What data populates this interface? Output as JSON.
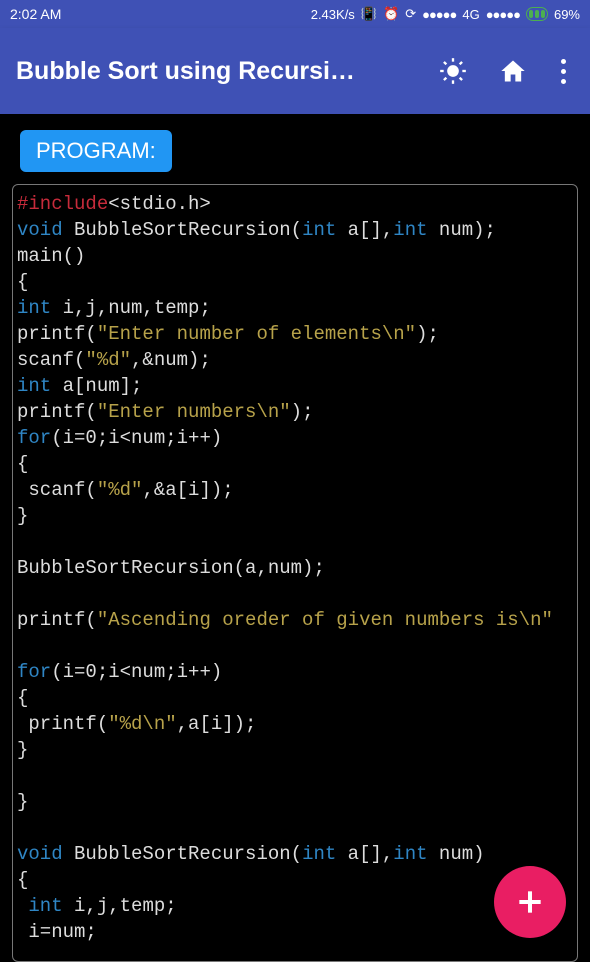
{
  "status": {
    "time": "2:02 AM",
    "net_speed": "2.43K/s",
    "network_label": "4G",
    "battery_pct": "69%"
  },
  "appbar": {
    "title": "Bubble Sort using Recursi…"
  },
  "section": {
    "program_label": "PROGRAM:"
  },
  "code": {
    "tokens": [
      {
        "t": "kw-pre",
        "v": "#include"
      },
      {
        "t": "txt",
        "v": "<stdio.h>\n"
      },
      {
        "t": "kw-type",
        "v": "void"
      },
      {
        "t": "txt",
        "v": " BubbleSortRecursion("
      },
      {
        "t": "kw-type",
        "v": "int"
      },
      {
        "t": "txt",
        "v": " a[],"
      },
      {
        "t": "kw-type",
        "v": "int"
      },
      {
        "t": "txt",
        "v": " num);\n"
      },
      {
        "t": "txt",
        "v": "main()\n"
      },
      {
        "t": "txt",
        "v": "{\n"
      },
      {
        "t": "kw-type",
        "v": "int"
      },
      {
        "t": "txt",
        "v": " i,j,num,temp;\n"
      },
      {
        "t": "txt",
        "v": "printf("
      },
      {
        "t": "str",
        "v": "\"Enter number of elements\\n\""
      },
      {
        "t": "txt",
        "v": ");\n"
      },
      {
        "t": "txt",
        "v": "scanf("
      },
      {
        "t": "str",
        "v": "\"%d\""
      },
      {
        "t": "txt",
        "v": ",&num);\n"
      },
      {
        "t": "kw-type",
        "v": "int"
      },
      {
        "t": "txt",
        "v": " a[num];\n"
      },
      {
        "t": "txt",
        "v": "printf("
      },
      {
        "t": "str",
        "v": "\"Enter numbers\\n\""
      },
      {
        "t": "txt",
        "v": ");\n"
      },
      {
        "t": "kw-type",
        "v": "for"
      },
      {
        "t": "txt",
        "v": "(i=0;i<num;i++)\n"
      },
      {
        "t": "txt",
        "v": "{\n"
      },
      {
        "t": "txt",
        "v": " scanf("
      },
      {
        "t": "str",
        "v": "\"%d\""
      },
      {
        "t": "txt",
        "v": ",&a[i]);\n"
      },
      {
        "t": "txt",
        "v": "}\n"
      },
      {
        "t": "txt",
        "v": "\n"
      },
      {
        "t": "txt",
        "v": "BubbleSortRecursion(a,num);\n"
      },
      {
        "t": "txt",
        "v": "\n"
      },
      {
        "t": "txt",
        "v": "printf("
      },
      {
        "t": "str",
        "v": "\"Ascending oreder of given numbers is\\n\""
      },
      {
        "t": "txt",
        "v": "\n"
      },
      {
        "t": "txt",
        "v": "\n"
      },
      {
        "t": "kw-type",
        "v": "for"
      },
      {
        "t": "txt",
        "v": "(i=0;i<num;i++)\n"
      },
      {
        "t": "txt",
        "v": "{\n"
      },
      {
        "t": "txt",
        "v": " printf("
      },
      {
        "t": "str",
        "v": "\"%d\\n\""
      },
      {
        "t": "txt",
        "v": ",a[i]);\n"
      },
      {
        "t": "txt",
        "v": "}\n"
      },
      {
        "t": "txt",
        "v": "\n"
      },
      {
        "t": "txt",
        "v": "}\n"
      },
      {
        "t": "txt",
        "v": "\n"
      },
      {
        "t": "kw-type",
        "v": "void"
      },
      {
        "t": "txt",
        "v": " BubbleSortRecursion("
      },
      {
        "t": "kw-type",
        "v": "int"
      },
      {
        "t": "txt",
        "v": " a[],"
      },
      {
        "t": "kw-type",
        "v": "int"
      },
      {
        "t": "txt",
        "v": " num)\n"
      },
      {
        "t": "txt",
        "v": "{\n"
      },
      {
        "t": "txt",
        "v": " "
      },
      {
        "t": "kw-type",
        "v": "int"
      },
      {
        "t": "txt",
        "v": " i,j,temp;\n"
      },
      {
        "t": "txt",
        "v": " i=num;\n"
      }
    ]
  }
}
